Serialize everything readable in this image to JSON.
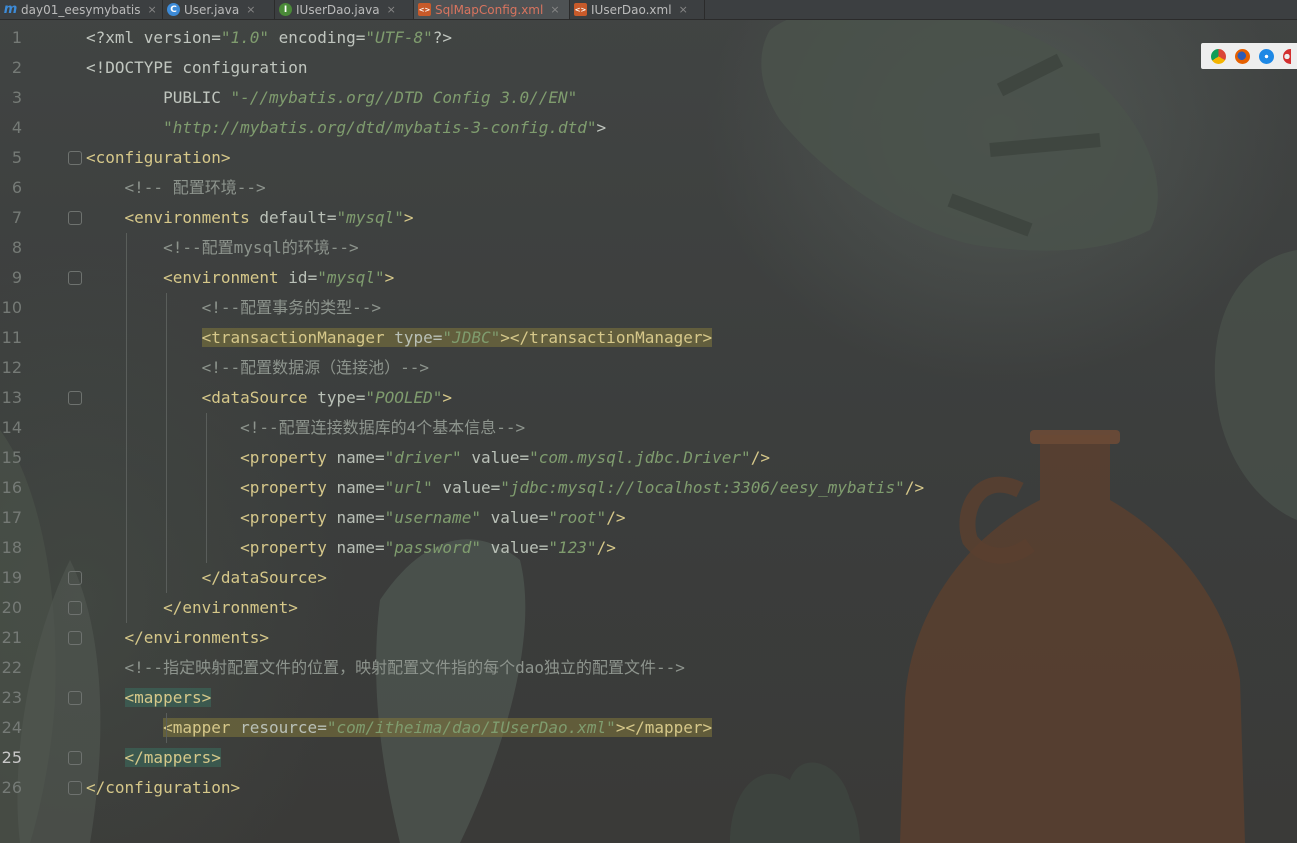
{
  "tabs": [
    {
      "label": "day01_eesymybatis",
      "icon": "m-module-icon",
      "active": false,
      "modified": false
    },
    {
      "label": "User.java",
      "icon": "class-icon",
      "active": false,
      "modified": false
    },
    {
      "label": "IUserDao.java",
      "icon": "interface-icon",
      "active": false,
      "modified": false
    },
    {
      "label": "SqlMapConfig.xml",
      "icon": "xml-file-icon",
      "active": true,
      "modified": true
    },
    {
      "label": "IUserDao.xml",
      "icon": "xml-file-icon",
      "active": false,
      "modified": false
    }
  ],
  "close_glyph": "×",
  "current_line": 25,
  "lines": [
    {
      "n": "1",
      "segs": [
        [
          "p",
          "<?xml version="
        ],
        [
          "s",
          "\"1.0\""
        ],
        [
          "p",
          " encoding="
        ],
        [
          "s",
          "\"UTF-8\""
        ],
        [
          "p",
          "?>"
        ]
      ]
    },
    {
      "n": "2",
      "segs": [
        [
          "p",
          "<!DOCTYPE configuration"
        ]
      ]
    },
    {
      "n": "3",
      "segs": [
        [
          "p",
          "        PUBLIC "
        ],
        [
          "s",
          "\"-//mybatis.org//DTD Config 3.0//EN\""
        ]
      ]
    },
    {
      "n": "4",
      "segs": [
        [
          "p",
          "        "
        ],
        [
          "s",
          "\"http://mybatis.org/dtd/mybatis-3-config.dtd\""
        ],
        [
          "p",
          ">"
        ]
      ]
    },
    {
      "n": "5",
      "segs": [
        [
          "t",
          "<configuration>"
        ]
      ]
    },
    {
      "n": "6",
      "segs": [
        [
          "p",
          "    "
        ],
        [
          "c",
          "<!-- 配置环境-->"
        ]
      ]
    },
    {
      "n": "7",
      "segs": [
        [
          "p",
          "    "
        ],
        [
          "t",
          "<environments "
        ],
        [
          "a",
          "default="
        ],
        [
          "s",
          "\"mysql\""
        ],
        [
          "t",
          ">"
        ]
      ]
    },
    {
      "n": "8",
      "segs": [
        [
          "p",
          "        "
        ],
        [
          "c",
          "<!--配置mysql的环境-->"
        ]
      ]
    },
    {
      "n": "9",
      "segs": [
        [
          "p",
          "        "
        ],
        [
          "t",
          "<environment "
        ],
        [
          "a",
          "id="
        ],
        [
          "s",
          "\"mysql\""
        ],
        [
          "t",
          ">"
        ]
      ]
    },
    {
      "n": "10",
      "segs": [
        [
          "p",
          "            "
        ],
        [
          "c",
          "<!--配置事务的类型-->"
        ]
      ]
    },
    {
      "n": "11",
      "segs": [
        [
          "p",
          "            "
        ],
        [
          "th",
          "<transactionManager "
        ],
        [
          "ah",
          "type="
        ],
        [
          "sh",
          "\"JDBC\""
        ],
        [
          "th",
          "></transactionManager>"
        ]
      ]
    },
    {
      "n": "12",
      "segs": [
        [
          "p",
          "            "
        ],
        [
          "c",
          "<!--配置数据源（连接池）-->"
        ]
      ]
    },
    {
      "n": "13",
      "segs": [
        [
          "p",
          "            "
        ],
        [
          "t",
          "<dataSource "
        ],
        [
          "a",
          "type="
        ],
        [
          "s",
          "\"POOLED\""
        ],
        [
          "t",
          ">"
        ]
      ]
    },
    {
      "n": "14",
      "segs": [
        [
          "p",
          "                "
        ],
        [
          "c",
          "<!--配置连接数据库的4个基本信息-->"
        ]
      ]
    },
    {
      "n": "15",
      "segs": [
        [
          "p",
          "                "
        ],
        [
          "t",
          "<property "
        ],
        [
          "a",
          "name="
        ],
        [
          "s",
          "\"driver\""
        ],
        [
          "a",
          " value="
        ],
        [
          "s",
          "\"com.mysql.jdbc.Driver\""
        ],
        [
          "t",
          "/>"
        ]
      ]
    },
    {
      "n": "16",
      "segs": [
        [
          "p",
          "                "
        ],
        [
          "t",
          "<property "
        ],
        [
          "a",
          "name="
        ],
        [
          "s",
          "\"url\""
        ],
        [
          "a",
          " value="
        ],
        [
          "s",
          "\"jdbc:mysql://localhost:3306/eesy_mybatis\""
        ],
        [
          "t",
          "/>"
        ]
      ]
    },
    {
      "n": "17",
      "segs": [
        [
          "p",
          "                "
        ],
        [
          "t",
          "<property "
        ],
        [
          "a",
          "name="
        ],
        [
          "s",
          "\"username\""
        ],
        [
          "a",
          " value="
        ],
        [
          "s",
          "\"root\""
        ],
        [
          "t",
          "/>"
        ]
      ]
    },
    {
      "n": "18",
      "segs": [
        [
          "p",
          "                "
        ],
        [
          "t",
          "<property "
        ],
        [
          "a",
          "name="
        ],
        [
          "s",
          "\"password\""
        ],
        [
          "a",
          " value="
        ],
        [
          "s",
          "\"123\""
        ],
        [
          "t",
          "/>"
        ]
      ]
    },
    {
      "n": "19",
      "segs": [
        [
          "p",
          "            "
        ],
        [
          "t",
          "</dataSource>"
        ]
      ]
    },
    {
      "n": "20",
      "segs": [
        [
          "p",
          "        "
        ],
        [
          "t",
          "</environment>"
        ]
      ]
    },
    {
      "n": "21",
      "segs": [
        [
          "p",
          "    "
        ],
        [
          "t",
          "</environments>"
        ]
      ]
    },
    {
      "n": "22",
      "segs": [
        [
          "p",
          "    "
        ],
        [
          "c",
          "<!--指定映射配置文件的位置，映射配置文件指的每个dao独立的配置文件-->"
        ]
      ]
    },
    {
      "n": "23",
      "segs": [
        [
          "p",
          "    "
        ],
        [
          "tg",
          "<mappers>"
        ]
      ]
    },
    {
      "n": "24",
      "segs": [
        [
          "p",
          "    "
        ],
        [
          "p2",
          "    "
        ],
        [
          "th",
          "<mapper "
        ],
        [
          "ah",
          "resource="
        ],
        [
          "sh",
          "\"com/itheima/dao/IUserDao.xml\""
        ],
        [
          "th",
          "></mapper>"
        ]
      ]
    },
    {
      "n": "25",
      "segs": [
        [
          "p",
          "    "
        ],
        [
          "tg",
          "</mappers>"
        ]
      ]
    },
    {
      "n": "26",
      "segs": [
        [
          "t",
          "</configuration>"
        ]
      ]
    }
  ],
  "browser_icons": [
    "chrome-icon",
    "firefox-icon",
    "safari-icon",
    "opera-icon"
  ],
  "colors": {
    "tag": "#d6c88a",
    "string": "#7f9c6e",
    "comment": "#8d948d",
    "attribute": "#b9c0b7"
  }
}
